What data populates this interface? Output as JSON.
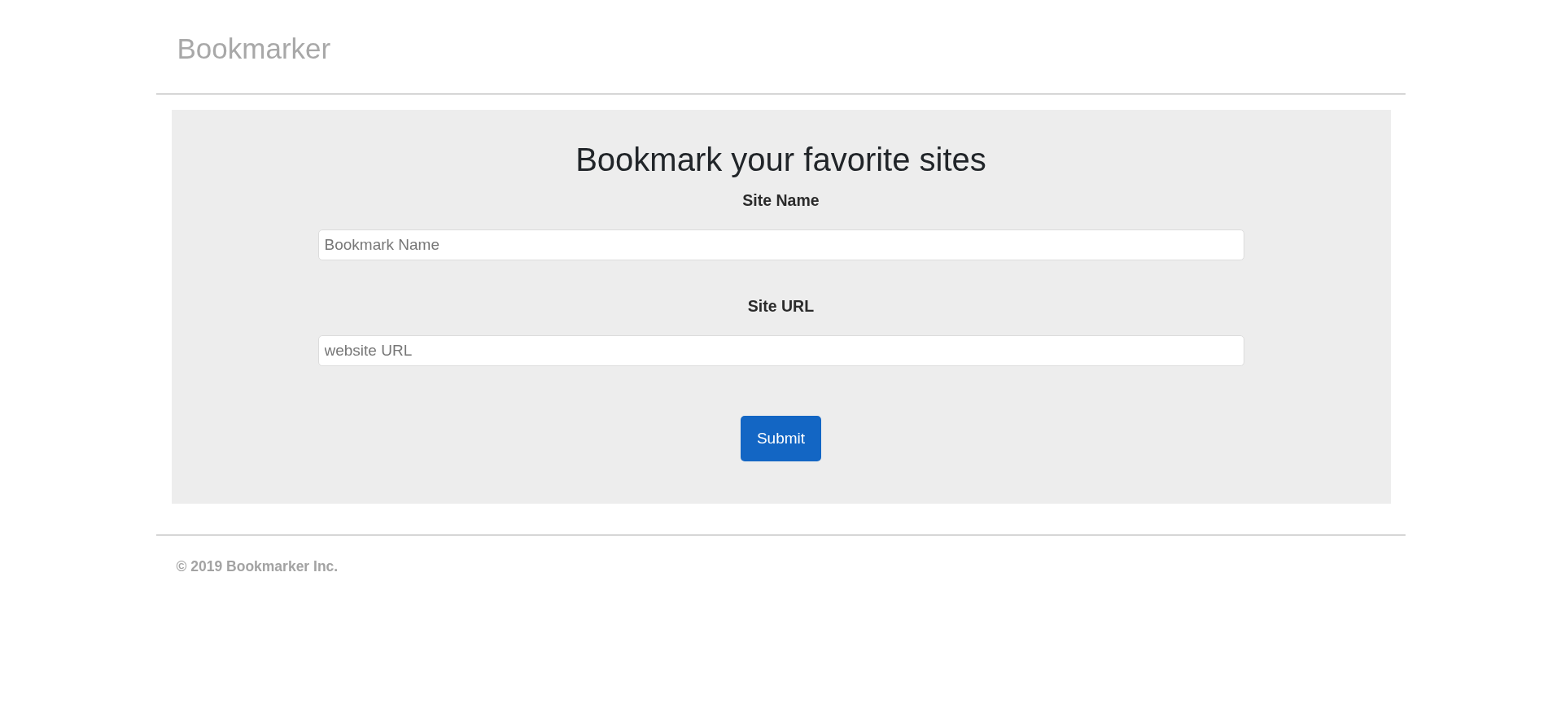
{
  "header": {
    "brand": "Bookmarker"
  },
  "form": {
    "title": "Bookmark your favorite sites",
    "fields": [
      {
        "label": "Site Name",
        "placeholder": "Bookmark Name"
      },
      {
        "label": "Site URL",
        "placeholder": "website URL"
      }
    ],
    "submit": "Submit"
  },
  "footer": {
    "text": "© 2019 Bookmarker Inc."
  }
}
